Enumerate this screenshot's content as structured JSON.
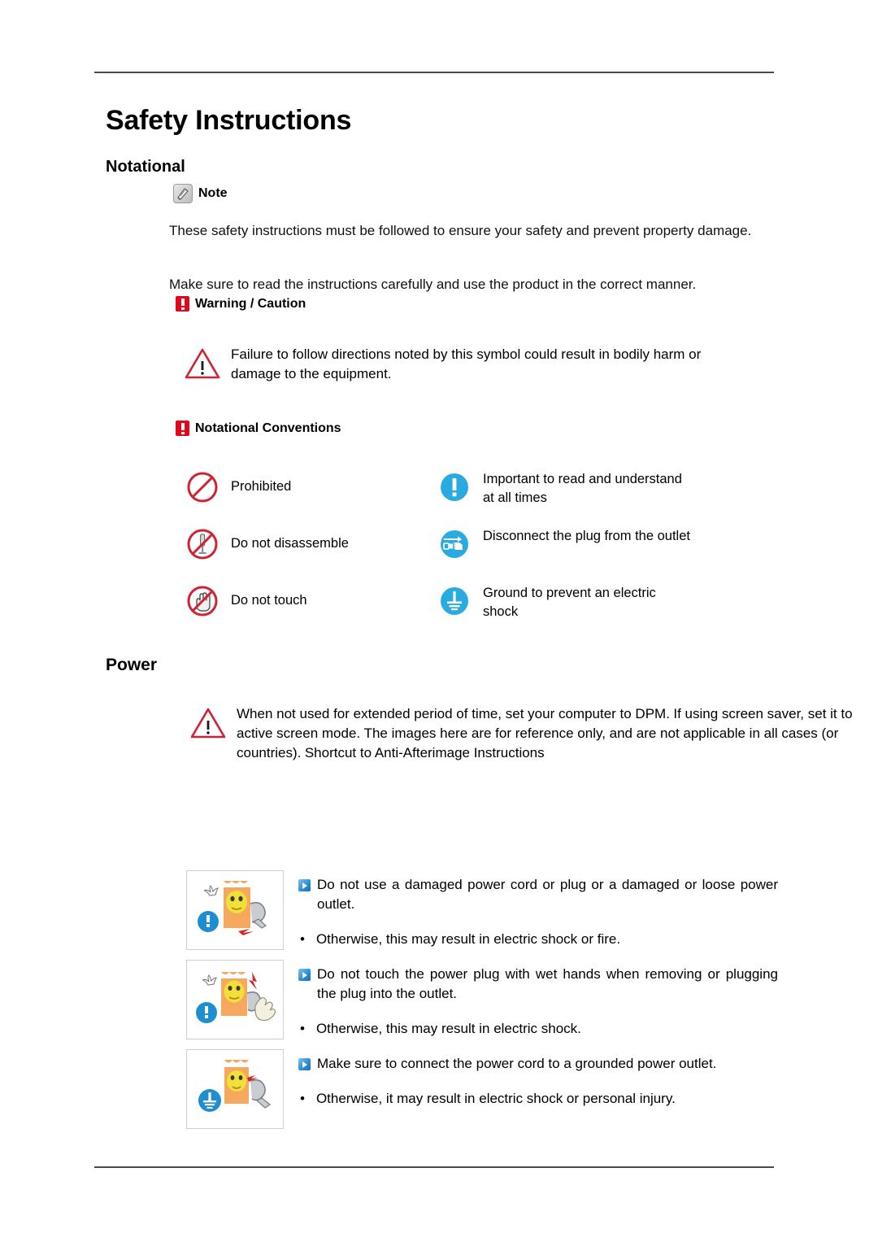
{
  "document": {
    "title": "Safety Instructions",
    "sections": {
      "notational": {
        "heading": "Notational",
        "note": {
          "icon": "note-pen-icon",
          "label": "Note"
        },
        "intro_paragraph": "These safety instructions must be followed to ensure your safety and prevent property damage.",
        "make_sure_paragraph": "Make sure to read the instructions carefully and use the product in the correct manner.",
        "warning_caution": {
          "icon": "red-exclamation-square-icon",
          "label": "Warning / Caution",
          "text": "Failure to follow directions noted by this symbol could result in bodily harm or damage to the equipment."
        },
        "conventions": {
          "icon": "red-exclamation-square-icon",
          "label": "Notational Conventions",
          "items": [
            {
              "icon": "prohibited-circle-icon",
              "label": "Prohibited",
              "column": "left"
            },
            {
              "icon": "important-exclamation-circle-icon",
              "label": "Important to read and understand at all times",
              "column": "right"
            },
            {
              "icon": "do-not-disassemble-icon",
              "label": "Do not disassemble",
              "column": "left"
            },
            {
              "icon": "disconnect-plug-icon",
              "label": "Disconnect the plug from the outlet",
              "column": "right"
            },
            {
              "icon": "do-not-touch-icon",
              "label": "Do not touch",
              "column": "left"
            },
            {
              "icon": "ground-icon",
              "label": "Ground to prevent an electric shock",
              "column": "right"
            }
          ]
        }
      },
      "power": {
        "heading": "Power",
        "warning_icon": "warning-triangle-icon",
        "paragraphs": [
          "When not used for extended period of time, set your computer to DPM.",
          "If using screen saver, set it to active screen mode.",
          "The images here are for reference only, and are not applicable in all cases (or countries).",
          "Shortcut to Anti-Afterimage Instructions"
        ],
        "items": [
          {
            "figure_icon": "damaged-power-cord-illustration",
            "figure_badge": "important-exclamation-circle-icon",
            "bullet_icon": "blue-arrow-bullet-icon",
            "instruction": "Do not use a damaged power cord or plug or a damaged or loose power outlet.",
            "consequence_marker": "•",
            "consequence": "Otherwise, this may result in electric shock or fire."
          },
          {
            "figure_icon": "wet-hands-plug-illustration",
            "figure_badge": "important-exclamation-circle-icon",
            "bullet_icon": "blue-arrow-bullet-icon",
            "instruction": "Do not touch the power plug with wet hands when removing or plugging the plug into the outlet.",
            "consequence_marker": "•",
            "consequence": "Otherwise, this may result in electric shock."
          },
          {
            "figure_icon": "grounded-outlet-illustration",
            "figure_badge": "ground-icon",
            "bullet_icon": "blue-arrow-bullet-icon",
            "instruction": "Make sure to connect the power cord to a grounded power outlet.",
            "consequence_marker": "•",
            "consequence": "Otherwise, it may result in electric shock or personal injury."
          }
        ]
      }
    }
  },
  "colors": {
    "warning_red": "#e2061a",
    "prohibition_red": "#cf2233",
    "info_blue": "#29abe2",
    "rule_gray": "#4a4a4a",
    "illustration_orange": "#f6a95e",
    "illustration_yellow": "#f2e03a"
  }
}
